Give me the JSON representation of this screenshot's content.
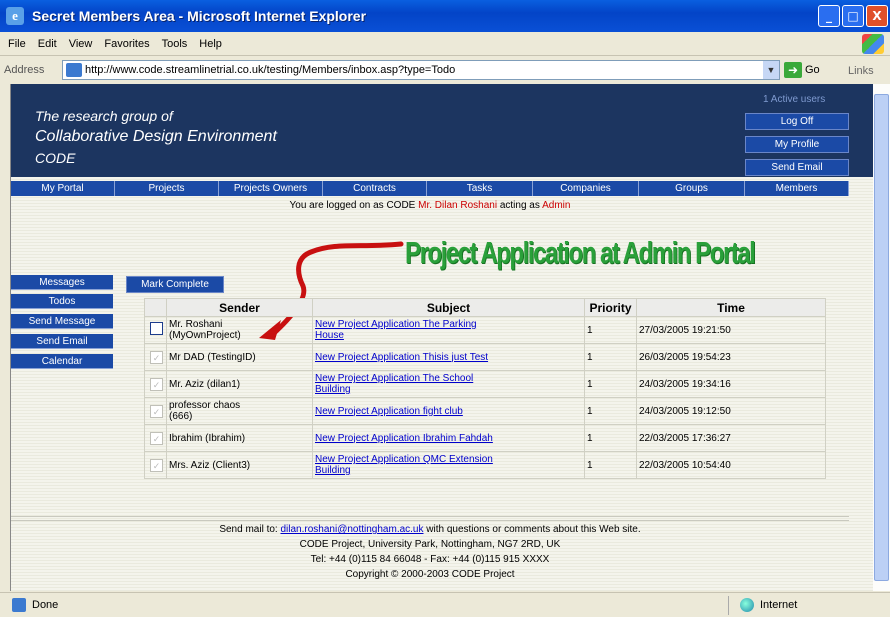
{
  "window": {
    "title": "Secret Members Area - Microsoft Internet Explorer",
    "controls": [
      "_",
      "□",
      "X"
    ]
  },
  "menu": [
    "File",
    "Edit",
    "View",
    "Favorites",
    "Tools",
    "Help"
  ],
  "address": {
    "label": "Address",
    "url": "http://www.code.streamlinetrial.co.uk/testing/Members/inbox.asp?type=Todo",
    "go": "Go",
    "links": "Links"
  },
  "header": {
    "line1": "The research group of",
    "line2": "Collaborative Design Environment",
    "line3": "CODE",
    "active_users": "1 Active users",
    "buttons": [
      "Log Off",
      "My Profile",
      "Send Email"
    ]
  },
  "nav": [
    "My Portal",
    "Projects",
    "Projects Owners",
    "Contracts",
    "Tasks",
    "Companies",
    "Groups",
    "Members"
  ],
  "login": {
    "prefix": "You are logged on as CODE",
    "user": "Mr. Dilan Roshani",
    "middle": "acting as",
    "role": "Admin"
  },
  "annotation": "Project Application at Admin Portal",
  "sidebar": [
    "Messages",
    "Todos",
    "Send Message",
    "Send Email",
    "Calendar"
  ],
  "mark_complete": "Mark Complete",
  "table": {
    "headers": [
      "Sender",
      "Subject",
      "Priority",
      "Time"
    ],
    "rows": [
      {
        "done": false,
        "sender_a": "Mr. Roshani",
        "sender_b": "(MyOwnProject)",
        "subject_a": "New Project Application The Parking",
        "subject_b": "House",
        "priority": "1",
        "time": "27/03/2005 19:21:50"
      },
      {
        "done": true,
        "sender_a": "Mr DAD (TestingID)",
        "sender_b": "",
        "subject_a": "New Project Application Thisis just Test",
        "subject_b": "",
        "priority": "1",
        "time": "26/03/2005 19:54:23"
      },
      {
        "done": true,
        "sender_a": "Mr. Aziz (dilan1)",
        "sender_b": "",
        "subject_a": "New Project Application The School",
        "subject_b": "Building",
        "priority": "1",
        "time": "24/03/2005 19:34:16"
      },
      {
        "done": true,
        "sender_a": "professor chaos",
        "sender_b": "(666)",
        "subject_a": "New Project Application fight club",
        "subject_b": "",
        "priority": "1",
        "time": "24/03/2005 19:12:50"
      },
      {
        "done": true,
        "sender_a": "Ibrahim (Ibrahim)",
        "sender_b": "",
        "subject_a": "New Project Application Ibrahim Fahdah",
        "subject_b": "",
        "priority": "1",
        "time": "22/03/2005 17:36:27"
      },
      {
        "done": true,
        "sender_a": "Mrs. Aziz (Client3)",
        "sender_b": "",
        "subject_a": "New Project Application QMC Extension",
        "subject_b": "Building",
        "priority": "1",
        "time": "22/03/2005 10:54:40"
      }
    ]
  },
  "footer": {
    "line1_pre": "Send mail to:",
    "email": "dilan.roshani@nottingham.ac.uk",
    "line1_post": "with questions or comments about this Web site.",
    "line2": "CODE Project, University Park, Nottingham, NG7 2RD, UK",
    "line3": "Tel: +44 (0)115 84 66048 - Fax: +44 (0)115 915 XXXX",
    "line4": "Copyright © 2000-2003 CODE Project"
  },
  "status": {
    "left": "Done",
    "zone": "Internet"
  },
  "colors": {
    "header_bg": "#1c3560",
    "nav_bg": "#1b4aa6",
    "annotation": "#2aa03a",
    "arrow": "#c81010"
  }
}
